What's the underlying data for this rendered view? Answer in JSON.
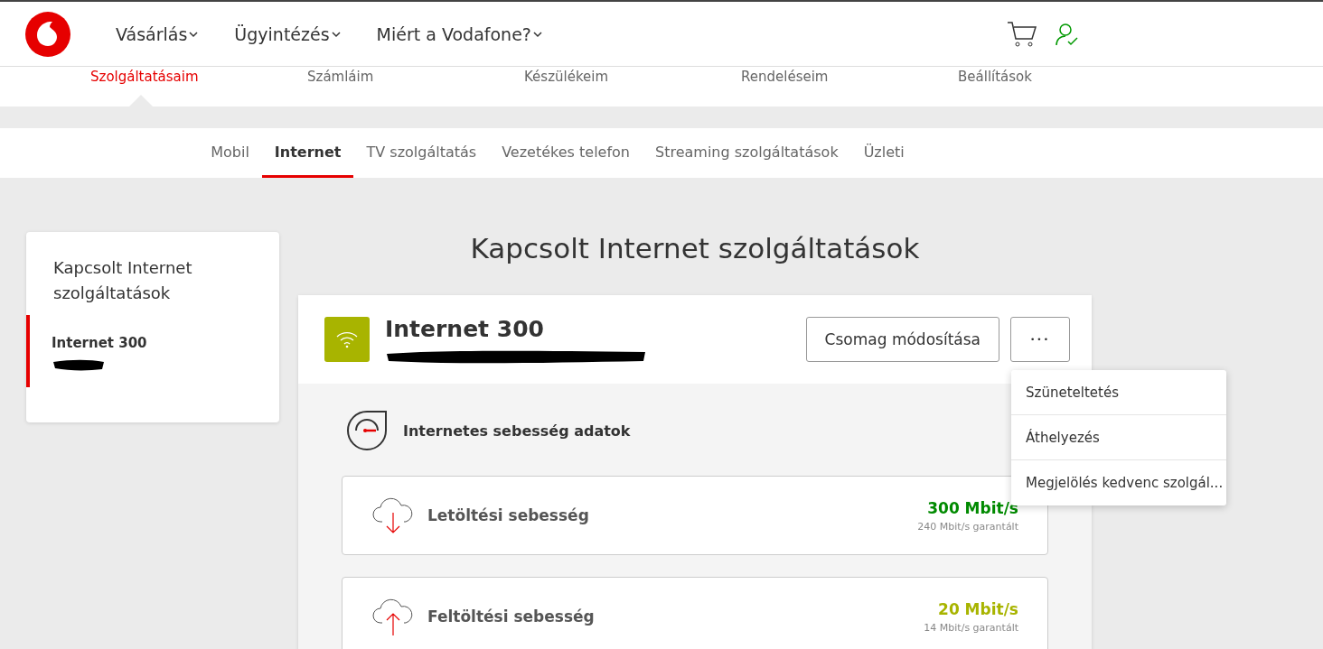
{
  "header": {
    "nav": [
      "Vásárlás",
      "Ügyintézés",
      "Miért a Vodafone?"
    ]
  },
  "account_nav": [
    {
      "label": "Szolgáltatásaim",
      "selected": true
    },
    {
      "label": "Számláim",
      "selected": false
    },
    {
      "label": "Készülékeim",
      "selected": false
    },
    {
      "label": "Rendeléseim",
      "selected": false
    },
    {
      "label": "Beállítások",
      "selected": false
    }
  ],
  "service_tabs": [
    {
      "label": "Mobil",
      "selected": false
    },
    {
      "label": "Internet",
      "selected": true
    },
    {
      "label": "TV szolgáltatás",
      "selected": false
    },
    {
      "label": "Vezetékes telefon",
      "selected": false
    },
    {
      "label": "Streaming szolgáltatások",
      "selected": false
    },
    {
      "label": "Üzleti",
      "selected": false
    }
  ],
  "sidebar": {
    "title": "Kapcsolt Internet szolgáltatások",
    "items": [
      {
        "label": "Internet 300",
        "selected": true
      }
    ]
  },
  "page_title": "Kapcsolt Internet szolgáltatások",
  "service_card": {
    "name": "Internet 300",
    "change_button": "Csomag módosítása",
    "more_button": "•••",
    "menu": [
      "Szüneteltetés",
      "Áthelyezés",
      "Megjelölés kedvenc szolgál..."
    ],
    "section_title": "Internetes sebesség adatok",
    "speeds": [
      {
        "kind": "download",
        "label": "Letöltési sebesség",
        "value": "300 Mbit/s",
        "guaranteed": "240 Mbit/s garantált",
        "color": "#008a00"
      },
      {
        "kind": "upload",
        "label": "Feltöltési sebesség",
        "value": "20 Mbit/s",
        "guaranteed": "14 Mbit/s garantált",
        "color": "#a8b400"
      }
    ]
  }
}
